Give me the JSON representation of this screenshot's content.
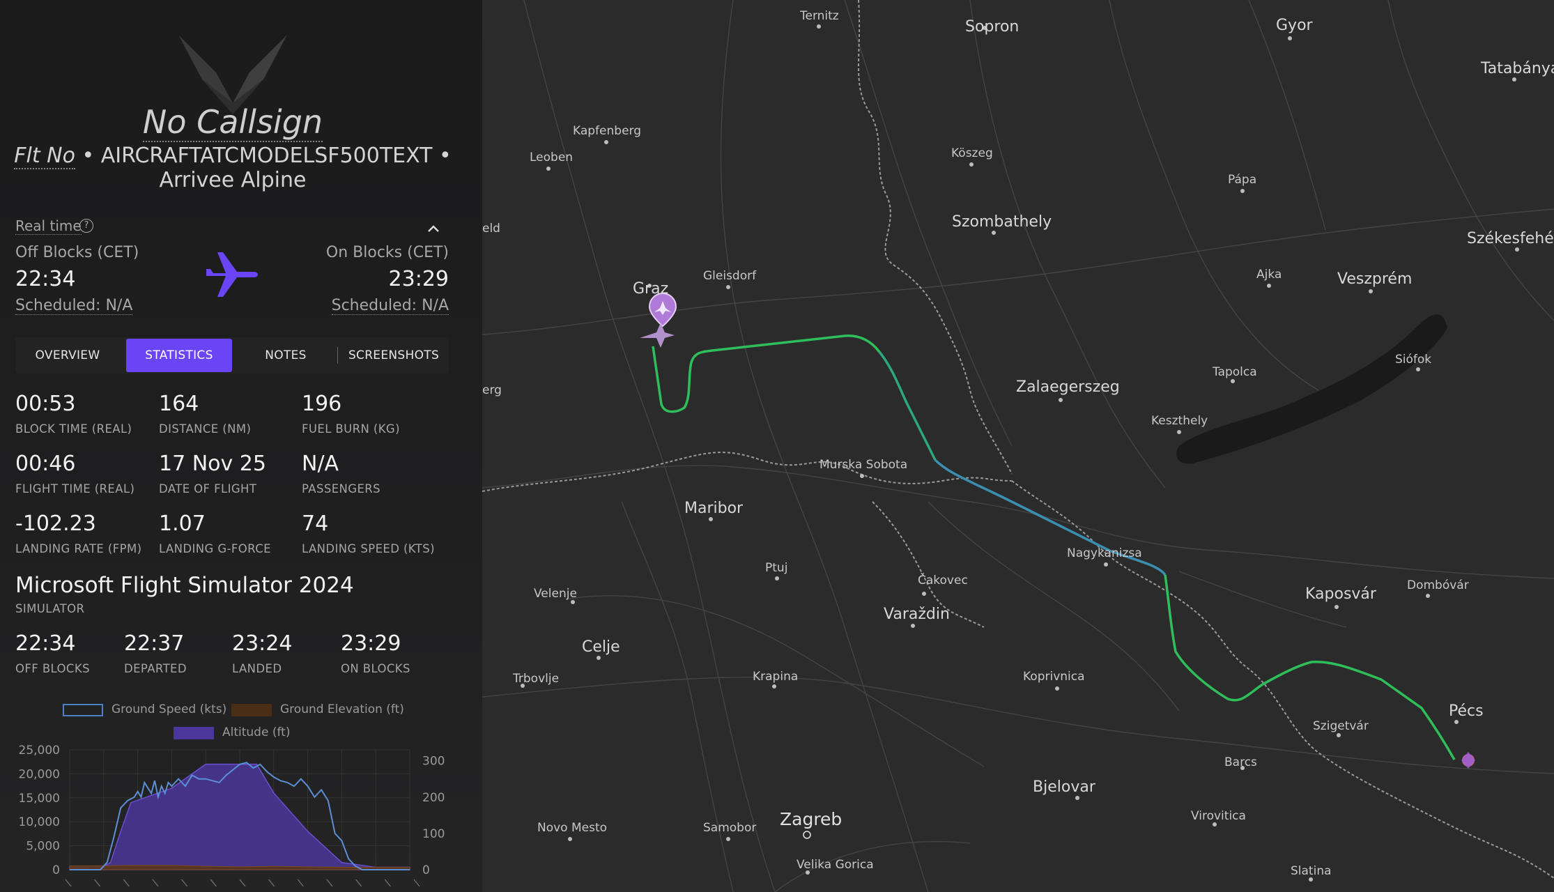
{
  "flight": {
    "callsign": "No Callsign",
    "flt_no": "Flt No",
    "sep1": " • ",
    "aircraft": "AIRCRAFTATCMODELSF500TEXT",
    "sep2": " •",
    "operator": "Arrivee Alpine"
  },
  "times_header": {
    "real_time": "Real time",
    "help": "?",
    "off_blocks_label": "Off Blocks (CET)",
    "off_blocks_time": "22:34",
    "off_scheduled": "Scheduled: N/A",
    "on_blocks_label": "On Blocks (CET)",
    "on_blocks_time": "23:29",
    "on_scheduled": "Scheduled: N/A"
  },
  "tabs": [
    {
      "label": "OVERVIEW"
    },
    {
      "label": "STATISTICS"
    },
    {
      "label": "NOTES"
    },
    {
      "label": "SCREENSHOTS"
    }
  ],
  "stats": [
    {
      "value": "00:53",
      "label": "BLOCK TIME (REAL)"
    },
    {
      "value": "164",
      "label": "DISTANCE (NM)"
    },
    {
      "value": "196",
      "label": "FUEL BURN (KG)"
    },
    {
      "value": "00:46",
      "label": "FLIGHT TIME (REAL)"
    },
    {
      "value": "17 Nov 25",
      "label": "DATE OF FLIGHT"
    },
    {
      "value": "N/A",
      "label": "PASSENGERS"
    },
    {
      "value": "-102.23",
      "label": "LANDING RATE (FPM)"
    },
    {
      "value": "1.07",
      "label": "LANDING G-FORCE"
    },
    {
      "value": "74",
      "label": "LANDING SPEED (KTS)"
    }
  ],
  "simulator": {
    "name": "Microsoft Flight Simulator 2024",
    "label": "SIMULATOR"
  },
  "phases": [
    {
      "value": "22:34",
      "label": "OFF BLOCKS"
    },
    {
      "value": "22:37",
      "label": "DEPARTED"
    },
    {
      "value": "23:24",
      "label": "LANDED"
    },
    {
      "value": "23:29",
      "label": "ON BLOCKS"
    }
  ],
  "chart_data": {
    "type": "line",
    "series": [
      {
        "name": "Ground Speed (kts)",
        "axis": "right",
        "color": "#5b8fd6",
        "x": [
          0,
          3,
          6,
          9,
          11,
          13,
          15,
          17,
          18,
          19,
          20,
          21,
          22,
          23,
          24,
          25,
          26,
          27,
          28,
          29,
          30,
          32,
          34,
          36,
          38,
          40,
          42,
          44,
          46,
          48,
          50,
          52,
          54,
          56,
          58,
          60,
          62,
          64,
          66,
          68,
          70,
          72,
          74,
          76,
          78,
          80,
          82,
          84,
          86,
          88,
          90,
          92,
          94,
          96,
          98,
          100
        ],
        "values": [
          0,
          0,
          0,
          0,
          20,
          90,
          170,
          190,
          195,
          200,
          215,
          200,
          240,
          225,
          210,
          245,
          200,
          230,
          210,
          240,
          230,
          250,
          230,
          260,
          250,
          250,
          245,
          240,
          260,
          275,
          290,
          295,
          280,
          290,
          270,
          255,
          245,
          240,
          230,
          250,
          230,
          200,
          220,
          190,
          100,
          80,
          30,
          10,
          0,
          0,
          0,
          0,
          0,
          0,
          0,
          0
        ]
      },
      {
        "name": "Ground Elevation (ft)",
        "axis": "left",
        "color": "#7a4a1e",
        "x": [
          0,
          10,
          20,
          30,
          40,
          50,
          60,
          70,
          80,
          90,
          100
        ],
        "values": [
          800,
          800,
          900,
          900,
          700,
          600,
          700,
          600,
          500,
          500,
          500
        ]
      },
      {
        "name": "Altitude (ft)",
        "axis": "left",
        "color": "#5a3fc0",
        "x": [
          0,
          5,
          10,
          12,
          15,
          18,
          22,
          30,
          40,
          55,
          60,
          70,
          80,
          90,
          100
        ],
        "values": [
          500,
          500,
          600,
          1500,
          8000,
          14000,
          15000,
          17000,
          22000,
          22000,
          16000,
          8000,
          1500,
          500,
          500
        ]
      }
    ],
    "ylim_left": [
      0,
      25000
    ],
    "yticks_left": [
      "25,000",
      "20,000",
      "15,000",
      "10,000",
      "5,000",
      "0"
    ],
    "ylim_right": [
      0,
      330
    ],
    "yticks_right": [
      "300",
      "200",
      "100",
      "0"
    ],
    "legend_position": "top"
  },
  "map": {
    "labels": [
      {
        "text": "Ternitz",
        "cls": ""
      },
      {
        "text": "Sopron",
        "cls": ""
      },
      {
        "text": "Gyor",
        "cls": ""
      },
      {
        "text": "Tatabánya",
        "cls": ""
      },
      {
        "text": "Kapfenberg",
        "cls": ""
      },
      {
        "text": "Leoben",
        "cls": ""
      },
      {
        "text": "Köszeg",
        "cls": ""
      },
      {
        "text": "Pápa",
        "cls": ""
      },
      {
        "text": "Szombathely",
        "cls": "big"
      },
      {
        "text": "Székesfehérv",
        "cls": "big"
      },
      {
        "text": "eld",
        "cls": ""
      },
      {
        "text": "Gleisdorf",
        "cls": ""
      },
      {
        "text": "Graz",
        "cls": "big"
      },
      {
        "text": "Ajka",
        "cls": ""
      },
      {
        "text": "Veszprém",
        "cls": "big"
      },
      {
        "text": "Siófok",
        "cls": ""
      },
      {
        "text": "erg",
        "cls": ""
      },
      {
        "text": "Zalaegerszeg",
        "cls": "big"
      },
      {
        "text": "Tapolca",
        "cls": ""
      },
      {
        "text": "Keszthely",
        "cls": ""
      },
      {
        "text": "Murska Sobota",
        "cls": ""
      },
      {
        "text": "Maribor",
        "cls": "big"
      },
      {
        "text": "Nagykanizsa",
        "cls": ""
      },
      {
        "text": "Ptuj",
        "cls": ""
      },
      {
        "text": "Čakovec",
        "cls": ""
      },
      {
        "text": "Kaposvár",
        "cls": "big"
      },
      {
        "text": "Dombóvár",
        "cls": ""
      },
      {
        "text": "Velenje",
        "cls": ""
      },
      {
        "text": "Varaždin",
        "cls": "big"
      },
      {
        "text": "Celje",
        "cls": "big"
      },
      {
        "text": "Koprivnica",
        "cls": ""
      },
      {
        "text": "Trbovlje",
        "cls": ""
      },
      {
        "text": "Krapina",
        "cls": ""
      },
      {
        "text": "Pécs",
        "cls": "big"
      },
      {
        "text": "Szigetvár",
        "cls": ""
      },
      {
        "text": "Barcs",
        "cls": ""
      },
      {
        "text": "Bjelovar",
        "cls": "big"
      },
      {
        "text": "Novo Mesto",
        "cls": ""
      },
      {
        "text": "Samobor",
        "cls": ""
      },
      {
        "text": "Zagreb",
        "cls": "huge"
      },
      {
        "text": "Virovitica",
        "cls": ""
      },
      {
        "text": "Velika Gorica",
        "cls": ""
      },
      {
        "text": "Slatina",
        "cls": ""
      }
    ]
  },
  "colors": {
    "accent": "#6a45f5",
    "route_green": "#2fbf5a",
    "route_teal": "#3aa3a8"
  }
}
